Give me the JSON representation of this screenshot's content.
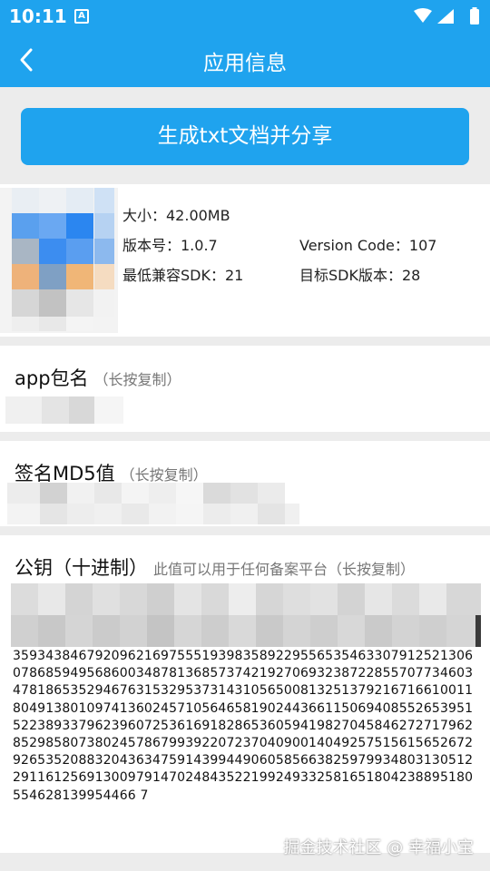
{
  "statusbar": {
    "time": "10:11",
    "notification_glyph": "A"
  },
  "toolbar": {
    "title": "应用信息",
    "back_icon": "chevron-left-icon"
  },
  "share_button": {
    "label": "生成txt文档并分享"
  },
  "info": {
    "size": "大小：42.00MB",
    "version_name": "版本号：1.0.7",
    "version_code": "Version Code：107",
    "min_sdk": "最低兼容SDK：21",
    "target_sdk": "目标SDK版本：28"
  },
  "package_section": {
    "title": "app包名",
    "hint": "（长按复制）"
  },
  "md5_section": {
    "title": "签名MD5值",
    "hint": "（长按复制）"
  },
  "pubkey_section": {
    "title": "公钥（十进制）",
    "hint": "此值可以用于任何备案平台（长按复制）",
    "value": "3593438467920962169755519398358922955653546330791252130607868594956860034878136857374219270693238722855707734603478186535294676315329537314310565008132513792167166100118049138010974136024571056465819024436611506940855265395152238933796239607253616918286536059419827045846272717962852985807380245786799392207237040900140492575156156526729265352088320436347591439944906058566382597993480313051229116125691300979147024843522199249332581651804238895180554628139954466 7"
  },
  "watermark": "掘金技术社区 @ 幸福小宝",
  "colors": {
    "accent": "#1fa3ee",
    "background": "#ececec",
    "card": "#ffffff"
  }
}
